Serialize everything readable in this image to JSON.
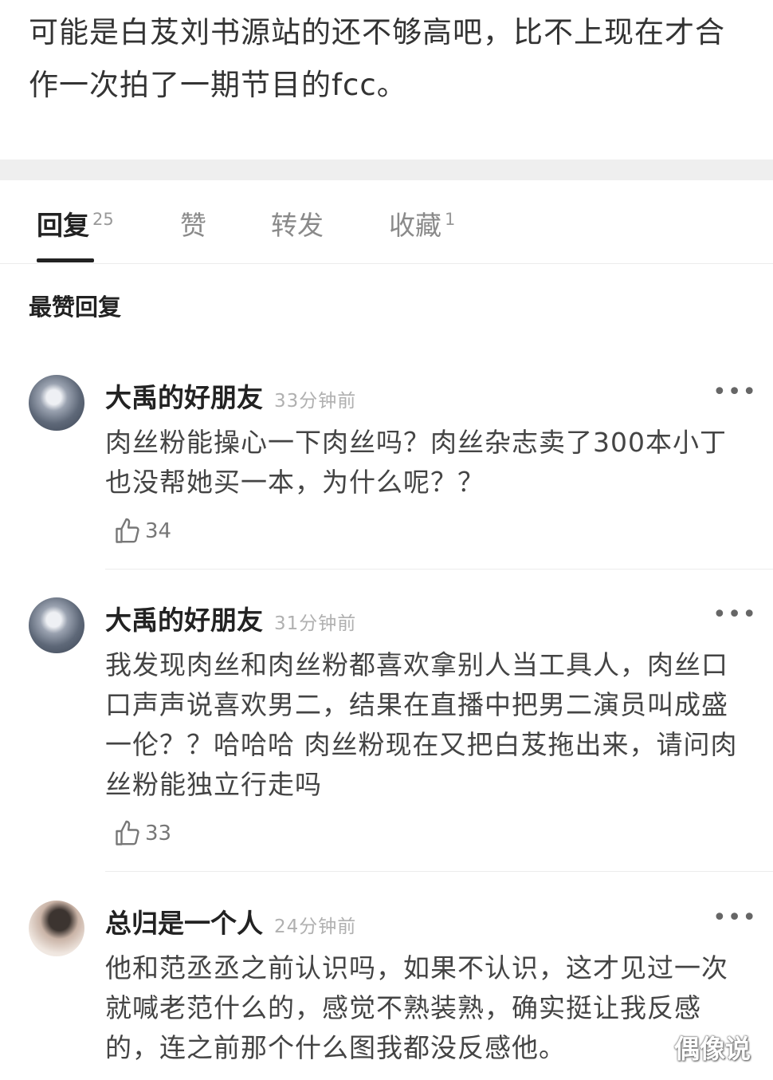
{
  "post": {
    "text": "可能是白芨刘书源站的还不够高吧，比不上现在才合作一次拍了一期节目的fcc。"
  },
  "tabs": [
    {
      "label": "回复",
      "count": "25"
    },
    {
      "label": "赞",
      "count": ""
    },
    {
      "label": "转发",
      "count": ""
    },
    {
      "label": "收藏",
      "count": "1"
    }
  ],
  "section_title": "最赞回复",
  "comments": [
    {
      "username": "大禹的好朋友",
      "time": "33分钟前",
      "more": "•••",
      "text": "肉丝粉能操心一下肉丝吗？肉丝杂志卖了300本小丁也没帮她买一本，为什么呢？？",
      "likes": "34"
    },
    {
      "username": "大禹的好朋友",
      "time": "31分钟前",
      "more": "•••",
      "text": "我发现肉丝和肉丝粉都喜欢拿别人当工具人，肉丝口口声声说喜欢男二，结果在直播中把男二演员叫成盛一伦？？哈哈哈 肉丝粉现在又把白芨拖出来，请问肉丝粉能独立行走吗",
      "likes": "33"
    },
    {
      "username": "总归是一个人",
      "time": "24分钟前",
      "more": "•••",
      "text": "他和范丞丞之前认识吗，如果不认识，这才见过一次就喊老范什么的，感觉不熟装熟，确实挺让我反感的，连之前那个什么图我都没反感他。"
    }
  ],
  "watermark": "偶像说",
  "icons": {
    "avatar_1": "avatar-image",
    "like": "thumbs-up-icon",
    "more": "more-dots-icon"
  }
}
